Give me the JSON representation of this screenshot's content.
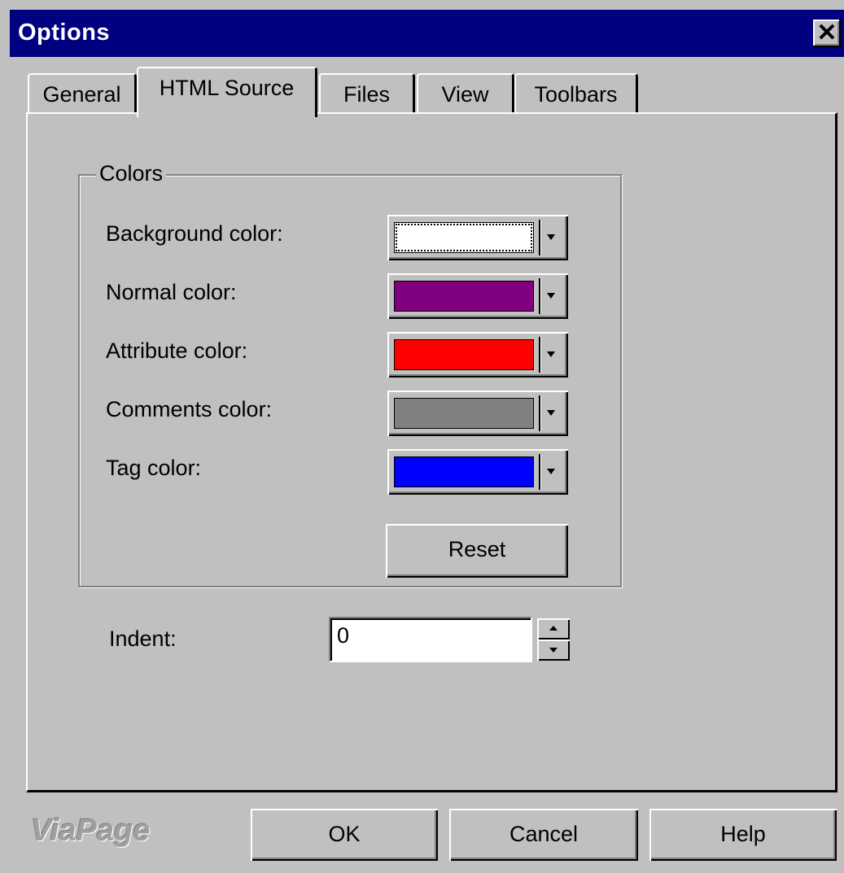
{
  "window": {
    "title": "Options",
    "close_label": "✕"
  },
  "tabs": [
    {
      "label": "General",
      "active": false
    },
    {
      "label": "HTML Source",
      "active": true
    },
    {
      "label": "Files",
      "active": false
    },
    {
      "label": "View",
      "active": false
    },
    {
      "label": "Toolbars",
      "active": false
    }
  ],
  "colors_group": {
    "legend": "Colors",
    "rows": [
      {
        "label": "Background color:",
        "color": "#ffffff"
      },
      {
        "label": "Normal color:",
        "color": "#800080"
      },
      {
        "label": "Attribute color:",
        "color": "#ff0000"
      },
      {
        "label": "Comments color:",
        "color": "#808080"
      },
      {
        "label": "Tag color:",
        "color": "#0000ff"
      }
    ],
    "reset_label": "Reset"
  },
  "indent": {
    "label": "Indent:",
    "value": "0"
  },
  "footer": {
    "brand": "ViaPage",
    "ok_label": "OK",
    "cancel_label": "Cancel",
    "help_label": "Help"
  }
}
